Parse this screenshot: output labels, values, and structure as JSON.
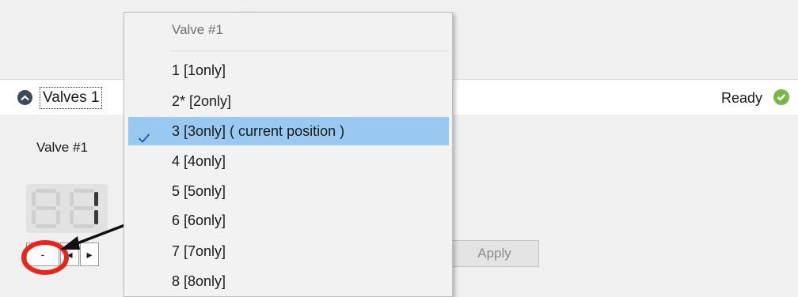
{
  "header": {
    "group_title": "Valves 1",
    "status": "Ready"
  },
  "valve": {
    "label": "Valve #1",
    "display_value": "1"
  },
  "stepper": {
    "minus": "-",
    "left": "◂",
    "right": "▸"
  },
  "apply_label": "Apply",
  "dropdown": {
    "header": "Valve #1",
    "items": [
      {
        "label": "1 [1only]",
        "selected": false
      },
      {
        "label": "2* [2only]",
        "selected": false
      },
      {
        "label": "3 [3only]  ( current position )",
        "selected": true
      },
      {
        "label": "4 [4only]",
        "selected": false
      },
      {
        "label": "5 [5only]",
        "selected": false
      },
      {
        "label": "6 [6only]",
        "selected": false
      },
      {
        "label": "7 [7only]",
        "selected": false
      },
      {
        "label": "8 [8only]",
        "selected": false
      }
    ]
  },
  "colors": {
    "selected_row": "#99c9f0",
    "status_ok": "#7ab648",
    "annotation": "#e8241c"
  },
  "icons": [
    "collapse-up-icon",
    "check-circle-icon",
    "checkmark-icon",
    "arrow-annotation-icon"
  ]
}
